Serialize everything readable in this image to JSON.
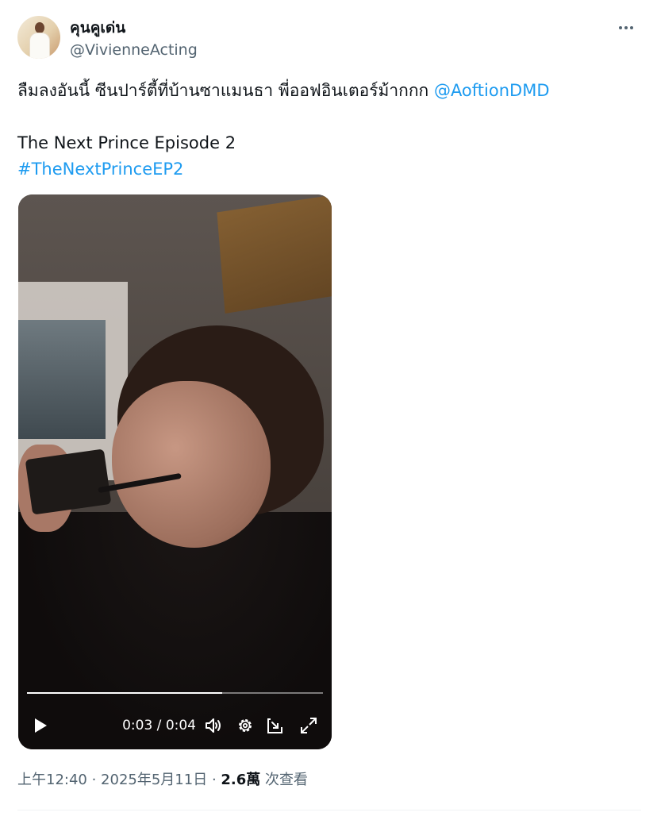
{
  "author": {
    "display_name": "คุนคูเด่น",
    "handle": "@VivienneActing"
  },
  "tweet": {
    "line1_text": "ลืมลงอันนี้ ซีนปาร์ตี้ที่บ้านซาแมนธา พี่ออฟอินเตอร์ม้ากกก ",
    "line1_mention": "@AoftionDMD",
    "line2_text": "The Next Prince Episode 2",
    "hashtag": "#TheNextPrinceEP2"
  },
  "video": {
    "current_time": "0:03",
    "separator": " / ",
    "duration": "0:04",
    "progress_fraction": 0.66,
    "controls": [
      "play-icon",
      "volume-icon",
      "settings-icon",
      "dock-icon",
      "fullscreen-icon"
    ]
  },
  "meta": {
    "time": "上午12:40",
    "sep1": " · ",
    "date": "2025年5月11日",
    "sep2": " · ",
    "views_count": "2.6萬",
    "views_label": " 次查看"
  },
  "colors": {
    "link": "#1d9bf0",
    "secondary_text": "#536471",
    "primary_text": "#0f1419"
  }
}
